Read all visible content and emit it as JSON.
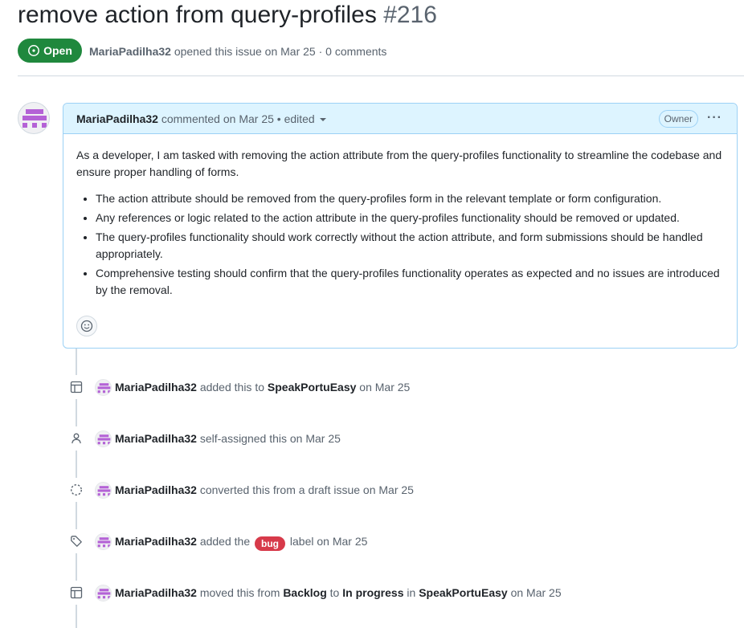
{
  "issue": {
    "title": "remove action from query-profiles",
    "number": "#216",
    "state": "Open",
    "author": "MariaPadilha32",
    "opened_text": "opened this issue on Mar 25 · 0 comments"
  },
  "comment": {
    "author": "MariaPadilha32",
    "meta": "commented on Mar 25 • edited",
    "role_badge": "Owner",
    "more_menu": "···",
    "intro": "As a developer, I am tasked with removing the action attribute from the query-profiles functionality to streamline the codebase and ensure proper handling of forms.",
    "bullets": [
      "The action attribute should be removed from the query-profiles form in the relevant template or form configuration.",
      "Any references or logic related to the action attribute in the query-profiles functionality should be removed or updated.",
      "The query-profiles functionality should work correctly without the action attribute, and form submissions should be handled appropriately.",
      "Comprehensive testing should confirm that the query-profiles functionality operates as expected and no issues are introduced by the removal."
    ]
  },
  "events": [
    {
      "icon": "project-table-icon",
      "user": "MariaPadilha32",
      "t1": "added this to",
      "project": "SpeakPortuEasy",
      "t2": "on Mar 25"
    },
    {
      "icon": "person-icon",
      "user": "MariaPadilha32",
      "t1": "self-assigned this on Mar 25"
    },
    {
      "icon": "draft-circle-icon",
      "user": "MariaPadilha32",
      "t1": "converted this from a draft issue on Mar 25"
    },
    {
      "icon": "tag-icon",
      "user": "MariaPadilha32",
      "t1": "added the",
      "label": "bug",
      "t2": "label on Mar 25"
    },
    {
      "icon": "project-table-icon",
      "user": "MariaPadilha32",
      "t1": "moved this from",
      "from": "Backlog",
      "to_word": "to",
      "to": "In progress",
      "in_word": "in",
      "project": "SpeakPortuEasy",
      "t2": "on Mar 25"
    }
  ],
  "colors": {
    "open_green": "#1f883d",
    "bug_red": "#d73a4a",
    "header_blue": "#ddf4ff",
    "avatar_purple": "#b462d6"
  }
}
